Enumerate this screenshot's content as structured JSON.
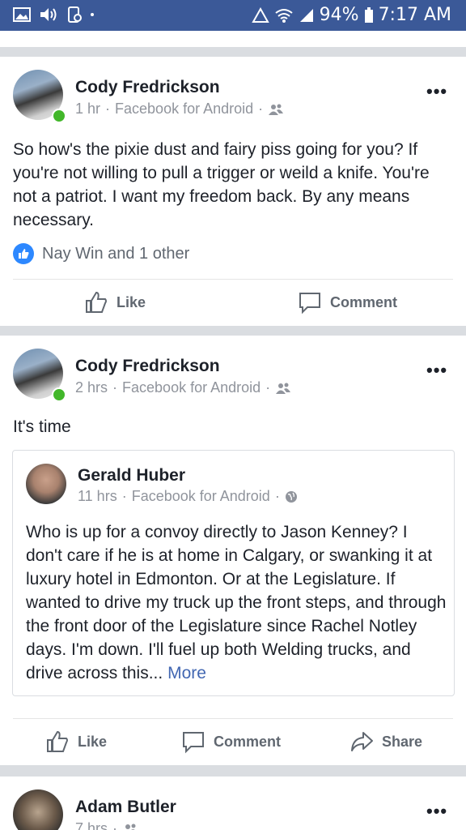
{
  "status_bar": {
    "battery": "94%",
    "time": "7:17 AM"
  },
  "posts": [
    {
      "author": "Cody Fredrickson",
      "time": "1 hr",
      "source": "Facebook for Android",
      "audience_icon": "friends-icon",
      "text": "So how's the pixie dust and fairy piss going for you? If you're not willing to pull a trigger or weild a knife. You're not a patriot. I want my freedom back. By any means necessary.",
      "reactions": "Nay Win and 1 other",
      "like_label": "Like",
      "comment_label": "Comment"
    },
    {
      "author": "Cody Fredrickson",
      "time": "2 hrs",
      "source": "Facebook for Android",
      "audience_icon": "friends-icon",
      "text": "It's time",
      "shared": {
        "author": "Gerald Huber",
        "time": "11 hrs",
        "source": "Facebook for Android",
        "audience_icon": "globe-icon",
        "text": "Who is up for a convoy directly to Jason Kenney? I don't care if he is at home in Calgary, or swanking it at luxury hotel in Edmonton. Or at the Legislature. If wanted to drive my truck up the front steps, and through the front door of the Legislature since Rachel Notley days. I'm down. I'll fuel up both Welding trucks, and drive across this...",
        "more_label": "More"
      },
      "like_label": "Like",
      "comment_label": "Comment",
      "share_label": "Share"
    },
    {
      "author": "Adam Butler",
      "time": "7 hrs"
    }
  ],
  "separator": "·",
  "colors": {
    "status_bar": "#3b5998",
    "online": "#42b72a",
    "link": "#4267b2",
    "like_badge": "#2d88ff"
  }
}
